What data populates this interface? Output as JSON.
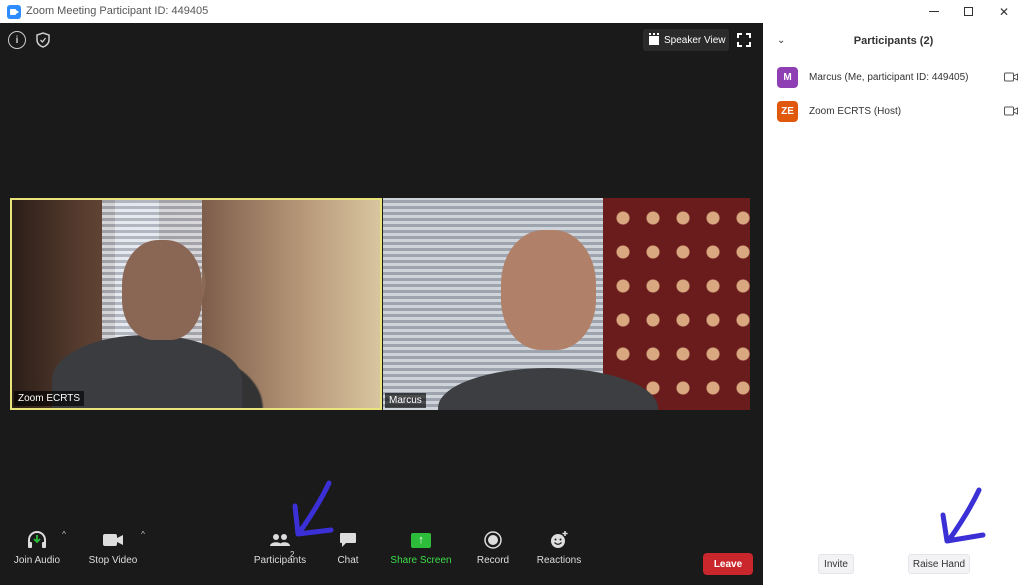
{
  "window": {
    "title": "Zoom Meeting Participant ID: 449405"
  },
  "meeting": {
    "speaker_view_label": "Speaker View",
    "tiles": [
      {
        "name": "Zoom ECRTS",
        "active_speaker": true
      },
      {
        "name": "Marcus",
        "active_speaker": false
      }
    ]
  },
  "toolbar": {
    "join_audio": "Join Audio",
    "stop_video": "Stop Video",
    "participants": "Participants",
    "participants_count": "2",
    "chat": "Chat",
    "share_screen": "Share Screen",
    "record": "Record",
    "reactions": "Reactions",
    "leave": "Leave"
  },
  "panel": {
    "title": "Participants (2)",
    "participants": [
      {
        "initials": "M",
        "name": "Marcus (Me, participant ID: 449405)",
        "avatar_color": "#8e3fb3"
      },
      {
        "initials": "ZE",
        "name": "Zoom ECRTS (Host)",
        "avatar_color": "#e0580b"
      }
    ],
    "invite_label": "Invite",
    "raise_hand_label": "Raise Hand"
  },
  "colors": {
    "meeting_bg": "#1a1a1a",
    "active_border": "#e8e37a",
    "share_green": "#2dbd3a",
    "leave_red": "#c9272c",
    "annotation_blue": "#3b2fd6"
  }
}
